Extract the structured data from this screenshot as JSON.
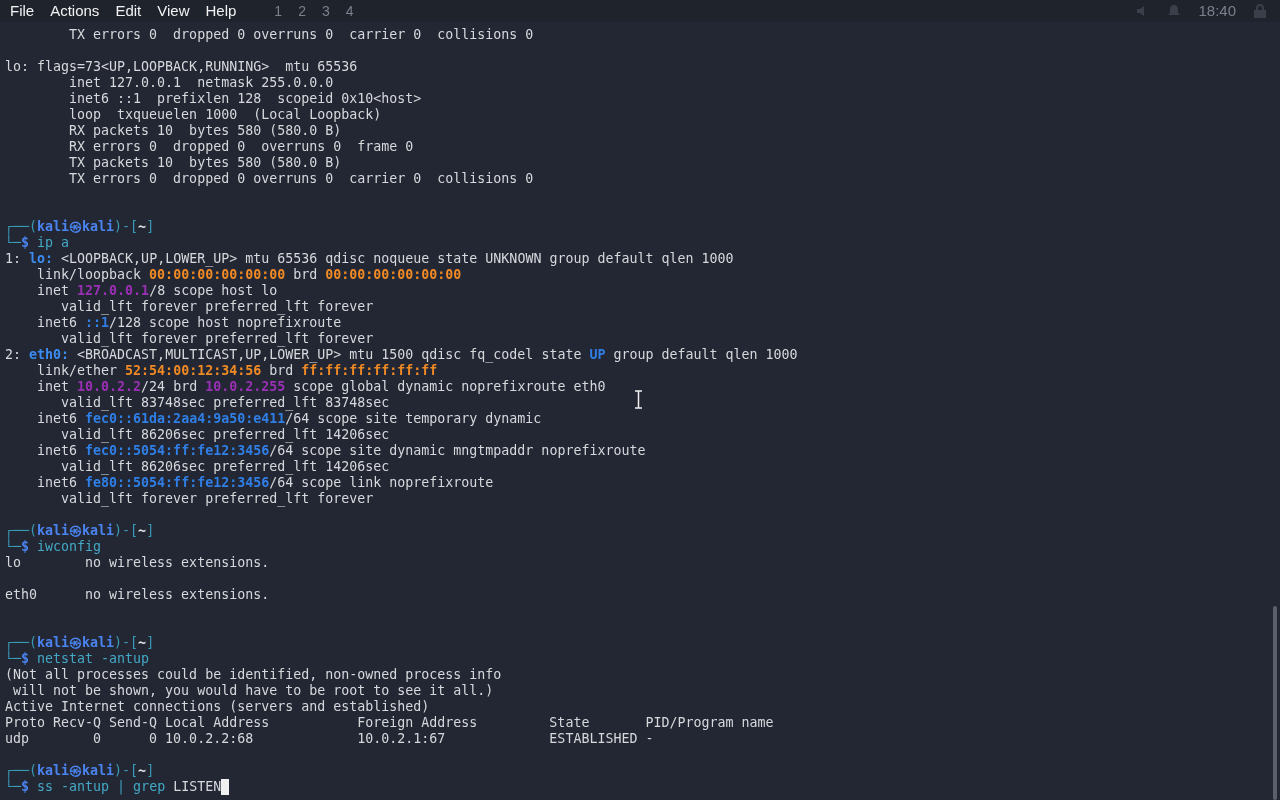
{
  "menu": [
    "File",
    "Actions",
    "Edit",
    "View",
    "Help"
  ],
  "panel": {
    "workspaces": [
      "1",
      "2",
      "3",
      "4"
    ],
    "clock": "18:40"
  },
  "lines": [
    {
      "kind": "text",
      "segments": [
        {
          "kind": "plain",
          "text": "        TX errors 0  dropped 0 overruns 0  carrier 0  collisions 0"
        }
      ]
    },
    {
      "kind": "blank"
    },
    {
      "kind": "text",
      "segments": [
        {
          "kind": "plain",
          "text": "lo: flags=73<UP,LOOPBACK,RUNNING>  mtu 65536"
        }
      ]
    },
    {
      "kind": "text",
      "segments": [
        {
          "kind": "plain",
          "text": "        inet 127.0.0.1  netmask 255.0.0.0"
        }
      ]
    },
    {
      "kind": "text",
      "segments": [
        {
          "kind": "plain",
          "text": "        inet6 ::1  prefixlen 128  scopeid 0x10<host>"
        }
      ]
    },
    {
      "kind": "text",
      "segments": [
        {
          "kind": "plain",
          "text": "        loop  txqueuelen 1000  (Local Loopback)"
        }
      ]
    },
    {
      "kind": "text",
      "segments": [
        {
          "kind": "plain",
          "text": "        RX packets 10  bytes 580 (580.0 B)"
        }
      ]
    },
    {
      "kind": "text",
      "segments": [
        {
          "kind": "plain",
          "text": "        RX errors 0  dropped 0  overruns 0  frame 0"
        }
      ]
    },
    {
      "kind": "text",
      "segments": [
        {
          "kind": "plain",
          "text": "        TX packets 10  bytes 580 (580.0 B)"
        }
      ]
    },
    {
      "kind": "text",
      "segments": [
        {
          "kind": "plain",
          "text": "        TX errors 0  dropped 0 overruns 0  carrier 0  collisions 0"
        }
      ]
    },
    {
      "kind": "blank"
    },
    {
      "kind": "blank"
    },
    {
      "kind": "text",
      "segments": [
        {
          "kind": "frame",
          "text": "┌──("
        },
        {
          "kind": "user",
          "text": "kali㉿kali"
        },
        {
          "kind": "frame",
          "text": ")-["
        },
        {
          "kind": "dir",
          "text": "~"
        },
        {
          "kind": "frame",
          "text": "]"
        }
      ]
    },
    {
      "kind": "text",
      "segments": [
        {
          "kind": "frame",
          "text": "└─"
        },
        {
          "kind": "user",
          "text": "$"
        },
        {
          "kind": "cmd",
          "text": " ip a"
        }
      ]
    },
    {
      "kind": "text",
      "segments": [
        {
          "kind": "plain",
          "text": "1: "
        },
        {
          "kind": "iface",
          "text": "lo:"
        },
        {
          "kind": "plain",
          "text": " <LOOPBACK,UP,LOWER_UP> mtu 65536 qdisc noqueue state UNKNOWN group default qlen 1000"
        }
      ]
    },
    {
      "kind": "text",
      "segments": [
        {
          "kind": "plain",
          "text": "    link/loopback "
        },
        {
          "kind": "mac",
          "text": "00:00:00:00:00:00"
        },
        {
          "kind": "plain",
          "text": " brd "
        },
        {
          "kind": "mac",
          "text": "00:00:00:00:00:00"
        }
      ]
    },
    {
      "kind": "text",
      "segments": [
        {
          "kind": "plain",
          "text": "    inet "
        },
        {
          "kind": "ip4",
          "text": "127.0.0.1"
        },
        {
          "kind": "plain",
          "text": "/8 scope host lo"
        }
      ]
    },
    {
      "kind": "text",
      "segments": [
        {
          "kind": "plain",
          "text": "       valid_lft forever preferred_lft forever"
        }
      ]
    },
    {
      "kind": "text",
      "segments": [
        {
          "kind": "plain",
          "text": "    inet6 "
        },
        {
          "kind": "ip6",
          "text": "::1"
        },
        {
          "kind": "plain",
          "text": "/128 scope host noprefixroute"
        }
      ]
    },
    {
      "kind": "text",
      "segments": [
        {
          "kind": "plain",
          "text": "       valid_lft forever preferred_lft forever"
        }
      ]
    },
    {
      "kind": "text",
      "segments": [
        {
          "kind": "plain",
          "text": "2: "
        },
        {
          "kind": "iface",
          "text": "eth0:"
        },
        {
          "kind": "plain",
          "text": " <BROADCAST,MULTICAST,UP,LOWER_UP> mtu 1500 qdisc fq_codel state "
        },
        {
          "kind": "ip6",
          "text": "UP"
        },
        {
          "kind": "plain",
          "text": " group default qlen 1000"
        }
      ]
    },
    {
      "kind": "text",
      "segments": [
        {
          "kind": "plain",
          "text": "    link/ether "
        },
        {
          "kind": "mac",
          "text": "52:54:00:12:34:56"
        },
        {
          "kind": "plain",
          "text": " brd "
        },
        {
          "kind": "mac",
          "text": "ff:ff:ff:ff:ff:ff"
        }
      ]
    },
    {
      "kind": "text",
      "segments": [
        {
          "kind": "plain",
          "text": "    inet "
        },
        {
          "kind": "ip4",
          "text": "10.0.2.2"
        },
        {
          "kind": "plain",
          "text": "/24 brd "
        },
        {
          "kind": "ip4",
          "text": "10.0.2.255"
        },
        {
          "kind": "plain",
          "text": " scope global dynamic noprefixroute eth0"
        }
      ]
    },
    {
      "kind": "text",
      "segments": [
        {
          "kind": "plain",
          "text": "       valid_lft 83748sec preferred_lft 83748sec"
        }
      ]
    },
    {
      "kind": "text",
      "segments": [
        {
          "kind": "plain",
          "text": "    inet6 "
        },
        {
          "kind": "ip6",
          "text": "fec0::61da:2aa4:9a50:e411"
        },
        {
          "kind": "plain",
          "text": "/64 scope site temporary dynamic"
        }
      ]
    },
    {
      "kind": "text",
      "segments": [
        {
          "kind": "plain",
          "text": "       valid_lft 86206sec preferred_lft 14206sec"
        }
      ]
    },
    {
      "kind": "text",
      "segments": [
        {
          "kind": "plain",
          "text": "    inet6 "
        },
        {
          "kind": "ip6",
          "text": "fec0::5054:ff:fe12:3456"
        },
        {
          "kind": "plain",
          "text": "/64 scope site dynamic mngtmpaddr noprefixroute"
        }
      ]
    },
    {
      "kind": "text",
      "segments": [
        {
          "kind": "plain",
          "text": "       valid_lft 86206sec preferred_lft 14206sec"
        }
      ]
    },
    {
      "kind": "text",
      "segments": [
        {
          "kind": "plain",
          "text": "    inet6 "
        },
        {
          "kind": "ip6",
          "text": "fe80::5054:ff:fe12:3456"
        },
        {
          "kind": "plain",
          "text": "/64 scope link noprefixroute"
        }
      ]
    },
    {
      "kind": "text",
      "segments": [
        {
          "kind": "plain",
          "text": "       valid_lft forever preferred_lft forever"
        }
      ]
    },
    {
      "kind": "blank"
    },
    {
      "kind": "text",
      "segments": [
        {
          "kind": "frame",
          "text": "┌──("
        },
        {
          "kind": "user",
          "text": "kali㉿kali"
        },
        {
          "kind": "frame",
          "text": ")-["
        },
        {
          "kind": "dir",
          "text": "~"
        },
        {
          "kind": "frame",
          "text": "]"
        }
      ]
    },
    {
      "kind": "text",
      "segments": [
        {
          "kind": "frame",
          "text": "└─"
        },
        {
          "kind": "user",
          "text": "$"
        },
        {
          "kind": "cmd",
          "text": " iwconfig"
        }
      ]
    },
    {
      "kind": "text",
      "segments": [
        {
          "kind": "plain",
          "text": "lo        no wireless extensions."
        }
      ]
    },
    {
      "kind": "blank"
    },
    {
      "kind": "text",
      "segments": [
        {
          "kind": "plain",
          "text": "eth0      no wireless extensions."
        }
      ]
    },
    {
      "kind": "blank"
    },
    {
      "kind": "blank"
    },
    {
      "kind": "text",
      "segments": [
        {
          "kind": "frame",
          "text": "┌──("
        },
        {
          "kind": "user",
          "text": "kali㉿kali"
        },
        {
          "kind": "frame",
          "text": ")-["
        },
        {
          "kind": "dir",
          "text": "~"
        },
        {
          "kind": "frame",
          "text": "]"
        }
      ]
    },
    {
      "kind": "text",
      "segments": [
        {
          "kind": "frame",
          "text": "└─"
        },
        {
          "kind": "user",
          "text": "$"
        },
        {
          "kind": "cmd",
          "text": " netstat -antup"
        }
      ]
    },
    {
      "kind": "text",
      "segments": [
        {
          "kind": "plain",
          "text": "(Not all processes could be identified, non-owned process info"
        }
      ]
    },
    {
      "kind": "text",
      "segments": [
        {
          "kind": "plain",
          "text": " will not be shown, you would have to be root to see it all.)"
        }
      ]
    },
    {
      "kind": "text",
      "segments": [
        {
          "kind": "plain",
          "text": "Active Internet connections (servers and established)"
        }
      ]
    },
    {
      "kind": "text",
      "segments": [
        {
          "kind": "plain",
          "text": "Proto Recv-Q Send-Q Local Address           Foreign Address         State       PID/Program name"
        }
      ]
    },
    {
      "kind": "text",
      "segments": [
        {
          "kind": "plain",
          "text": "udp        0      0 10.0.2.2:68             10.0.2.1:67             ESTABLISHED -"
        }
      ]
    },
    {
      "kind": "blank"
    },
    {
      "kind": "text",
      "segments": [
        {
          "kind": "frame",
          "text": "┌──("
        },
        {
          "kind": "user",
          "text": "kali㉿kali"
        },
        {
          "kind": "frame",
          "text": ")-["
        },
        {
          "kind": "dir",
          "text": "~"
        },
        {
          "kind": "frame",
          "text": "]"
        }
      ]
    },
    {
      "kind": "text",
      "cursor": true,
      "segments": [
        {
          "kind": "frame",
          "text": "└─"
        },
        {
          "kind": "user",
          "text": "$"
        },
        {
          "kind": "cmd",
          "text": " ss -antup "
        },
        {
          "kind": "pipe",
          "text": "|"
        },
        {
          "kind": "cmd",
          "text": " grep "
        },
        {
          "kind": "plain",
          "text": "LISTEN"
        }
      ]
    }
  ]
}
